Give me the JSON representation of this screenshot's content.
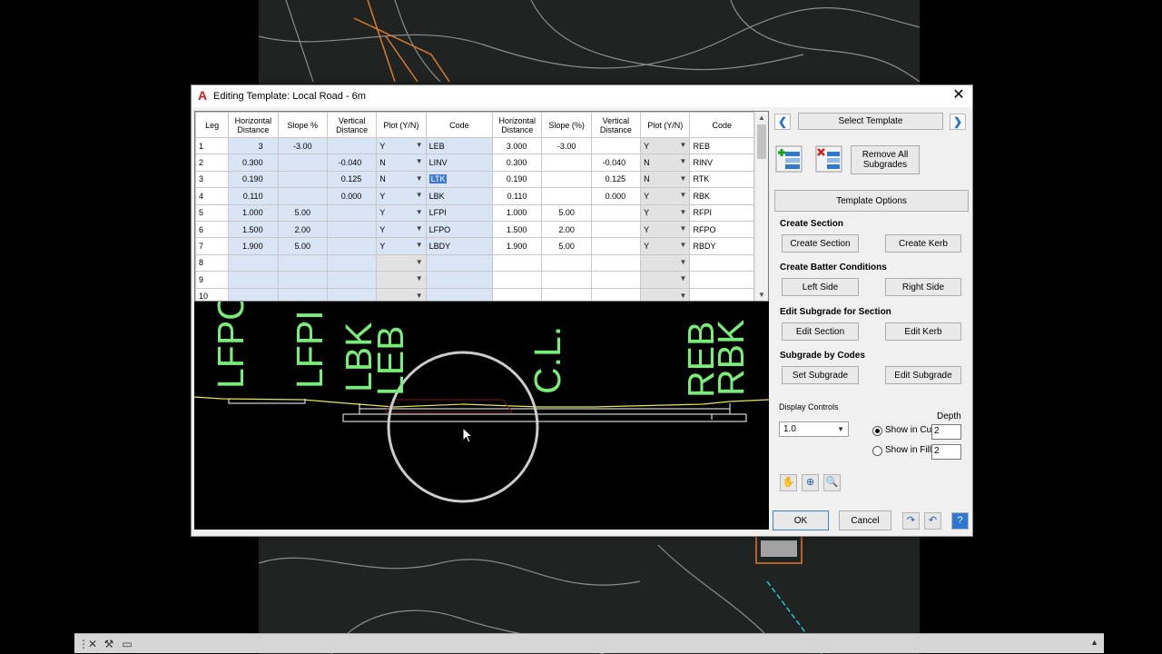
{
  "window": {
    "title": "Editing Template: Local Road - 6m",
    "close_glyph": "✕"
  },
  "grid": {
    "headers": [
      "Leg",
      "Horizontal Distance",
      "Slope %",
      "Vertical Distance",
      "Plot (Y/N)",
      "Code",
      "Horizontal Distance",
      "Slope (%)",
      "Vertical Distance",
      "Plot (Y/N)",
      "Code"
    ],
    "rows": [
      {
        "leg": "1",
        "lh": "3",
        "ls": "-3.00",
        "lv": "",
        "lp": "Y",
        "lc": "LEB",
        "rh": "3.000",
        "rs": "-3.00",
        "rv": "",
        "rp": "Y",
        "rc": "REB"
      },
      {
        "leg": "2",
        "lh": "0.300",
        "ls": "",
        "lv": "-0.040",
        "lp": "N",
        "lc": "LINV",
        "rh": "0.300",
        "rs": "",
        "rv": "-0.040",
        "rp": "N",
        "rc": "RINV"
      },
      {
        "leg": "3",
        "lh": "0.190",
        "ls": "",
        "lv": "0.125",
        "lp": "N",
        "lc": "LTK",
        "rh": "0.190",
        "rs": "",
        "rv": "0.125",
        "rp": "N",
        "rc": "RTK"
      },
      {
        "leg": "4",
        "lh": "0.110",
        "ls": "",
        "lv": "0.000",
        "lp": "Y",
        "lc": "LBK",
        "rh": "0.110",
        "rs": "",
        "rv": "0.000",
        "rp": "Y",
        "rc": "RBK"
      },
      {
        "leg": "5",
        "lh": "1.000",
        "ls": "5.00",
        "lv": "",
        "lp": "Y",
        "lc": "LFPI",
        "rh": "1.000",
        "rs": "5.00",
        "rv": "",
        "rp": "Y",
        "rc": "RFPI"
      },
      {
        "leg": "6",
        "lh": "1.500",
        "ls": "2.00",
        "lv": "",
        "lp": "Y",
        "lc": "LFPO",
        "rh": "1.500",
        "rs": "2.00",
        "rv": "",
        "rp": "Y",
        "rc": "RFPO"
      },
      {
        "leg": "7",
        "lh": "1.900",
        "ls": "5.00",
        "lv": "",
        "lp": "Y",
        "lc": "LBDY",
        "rh": "1.900",
        "rs": "5.00",
        "rv": "",
        "rp": "Y",
        "rc": "RBDY"
      },
      {
        "leg": "8",
        "lh": "",
        "ls": "",
        "lv": "",
        "lp": "",
        "lc": "",
        "rh": "",
        "rs": "",
        "rv": "",
        "rp": "",
        "rc": ""
      },
      {
        "leg": "9",
        "lh": "",
        "ls": "",
        "lv": "",
        "lp": "",
        "lc": "",
        "rh": "",
        "rs": "",
        "rv": "",
        "rp": "",
        "rc": ""
      },
      {
        "leg": "10",
        "lh": "",
        "ls": "",
        "lv": "",
        "lp": "",
        "lc": "",
        "rh": "",
        "rs": "",
        "rv": "",
        "rp": "",
        "rc": ""
      }
    ]
  },
  "preview": {
    "labels": [
      "LFPO",
      "LFPI",
      "LBK",
      "LEB",
      "C.L.",
      "REB",
      "RBK"
    ],
    "colors": {
      "labels": "#77ee77",
      "surface": "#e8e84a",
      "outline": "#ffffff",
      "zoom_circle": "#cccccc"
    }
  },
  "panel": {
    "prev_glyph": "❮",
    "next_glyph": "❯",
    "select_template": "Select Template",
    "remove_all": "Remove All Subgrades",
    "template_options": "Template Options",
    "create_section_title": "Create Section",
    "create_section": "Create Section",
    "create_kerb": "Create Kerb",
    "batter_title": "Create Batter Conditions",
    "left_side": "Left Side",
    "right_side": "Right Side",
    "edit_subgrade_title": "Edit Subgrade for Section",
    "edit_section": "Edit Section",
    "edit_kerb": "Edit Kerb",
    "subgrade_codes_title": "Subgrade by Codes",
    "set_subgrade": "Set Subgrade",
    "edit_subgrade": "Edit Subgrade",
    "display_controls": "Display Controls",
    "depth": "Depth",
    "scale_value": "1.0",
    "show_cut": "Show in Cut",
    "show_fill": "Show in Fill",
    "cut_depth": "2",
    "fill_depth": "2",
    "ok": "OK",
    "cancel": "Cancel"
  }
}
